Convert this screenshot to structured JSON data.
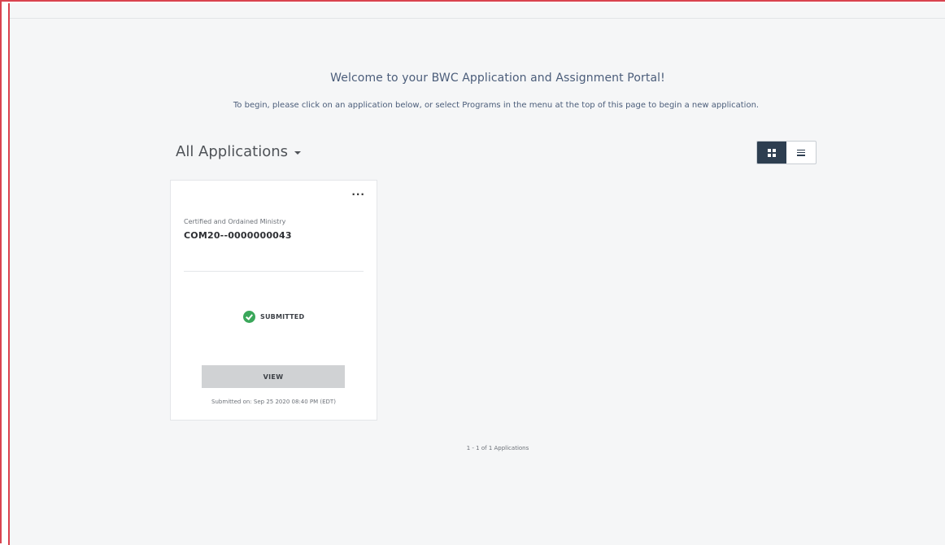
{
  "header": {
    "title": "Welcome to your BWC Application and Assignment Portal!",
    "subtitle": "To begin, please click on an application below, or select Programs in the menu at the top of this page to begin a new application."
  },
  "applications": {
    "heading": "All Applications",
    "view_modes": [
      {
        "name": "grid",
        "icon": "grid-icon",
        "active": true
      },
      {
        "name": "list",
        "icon": "list-icon",
        "active": false
      }
    ],
    "cards": [
      {
        "program": "Certified and Ordained Ministry",
        "id": "COM20--0000000043",
        "status": "SUBMITTED",
        "status_icon": "check-circle-icon",
        "status_color": "#3aa75a",
        "button_label": "VIEW",
        "submitted_on": "Submitted on: Sep 25 2020 08:40 PM (EDT)"
      }
    ],
    "pagination": "1 - 1 of 1 Applications"
  },
  "colors": {
    "accent_border": "#d9434f",
    "toggle_active": "#2d3e50",
    "text_heading": "#4b5d7a"
  }
}
